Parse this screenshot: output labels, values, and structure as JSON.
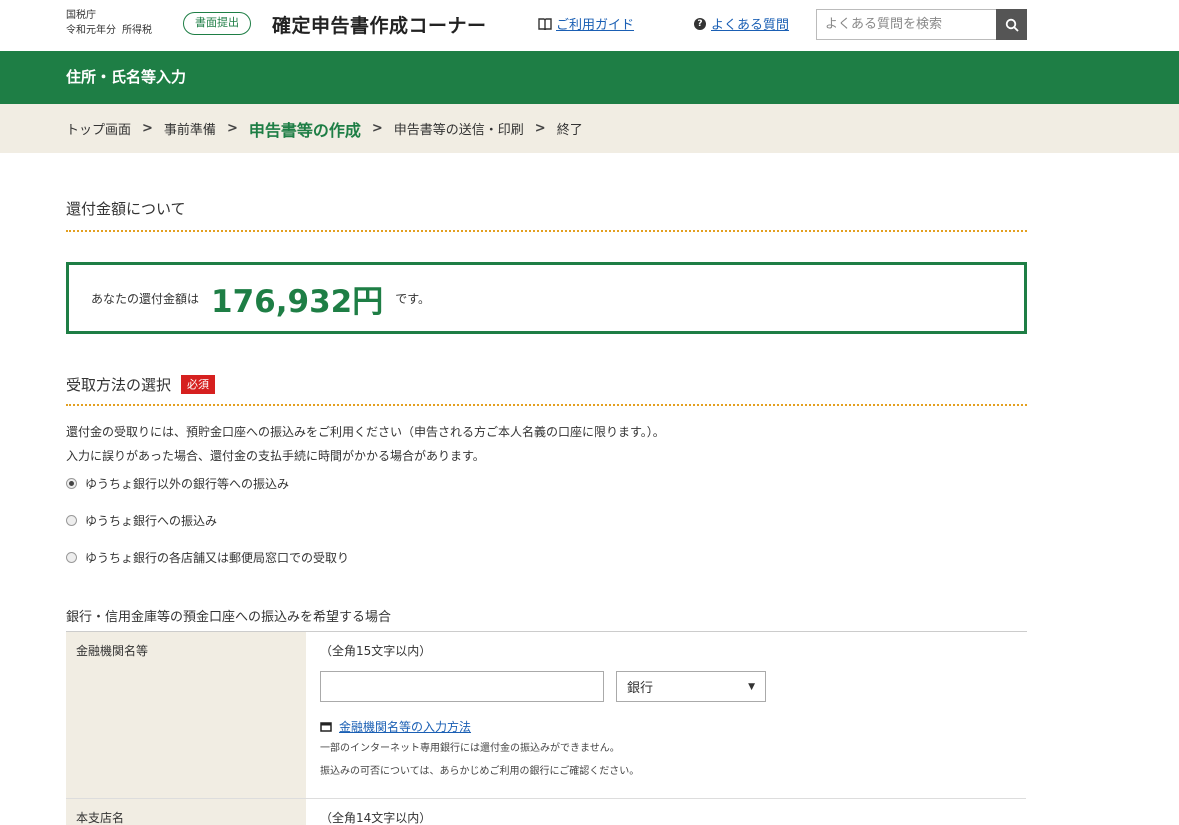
{
  "header": {
    "agency": "国税庁",
    "year": "令和元年分",
    "tax_type": "所得税",
    "mode_badge": "書面提出",
    "app_title": "確定申告書作成コーナー",
    "guide_link": "ご利用ガイド",
    "faq_link": "よくある質問",
    "search_placeholder": "よくある質問を検索"
  },
  "page_title": "住所・氏名等入力",
  "breadcrumb": [
    "トップ画面",
    "事前準備",
    "申告書等の作成",
    "申告書等の送信・印刷",
    "終了"
  ],
  "refund": {
    "heading": "還付金額について",
    "prefix": "あなたの還付金額は",
    "amount": "176,932円",
    "suffix": "です。"
  },
  "receipt": {
    "heading": "受取方法の選択",
    "required_badge": "必須",
    "note_1": "還付金の受取りには、預貯金口座への振込みをご利用ください（申告される方ご本人名義の口座に限ります。）。",
    "note_2": "入力に誤りがあった場合、還付金の支払手続に時間がかかる場合があります。",
    "options": [
      {
        "label": "ゆうちょ銀行以外の銀行等への振込み",
        "selected": true
      },
      {
        "label": "ゆうちょ銀行への振込み",
        "selected": false
      },
      {
        "label": "ゆうちょ銀行の各店舗又は郵便局窓口での受取り",
        "selected": false
      }
    ]
  },
  "bank_form": {
    "caption": "銀行・信用金庫等の預金口座への振込みを希望する場合",
    "institution": {
      "label": "金融機関名等",
      "hint": "（全角15文字以内）",
      "value": "",
      "type_selected": "銀行",
      "help_link": "金融機関名等の入力方法",
      "note_1": "一部のインターネット専用銀行には還付金の振込みができません。",
      "note_2": "振込みの可否については、あらかじめご利用の銀行にご確認ください。"
    },
    "branch": {
      "label": "本支店名",
      "hint": "（全角14文字以内）"
    }
  },
  "colors": {
    "brand_green": "#1e7e45",
    "required_red": "#d6201f",
    "divider_orange": "#e3a021"
  }
}
